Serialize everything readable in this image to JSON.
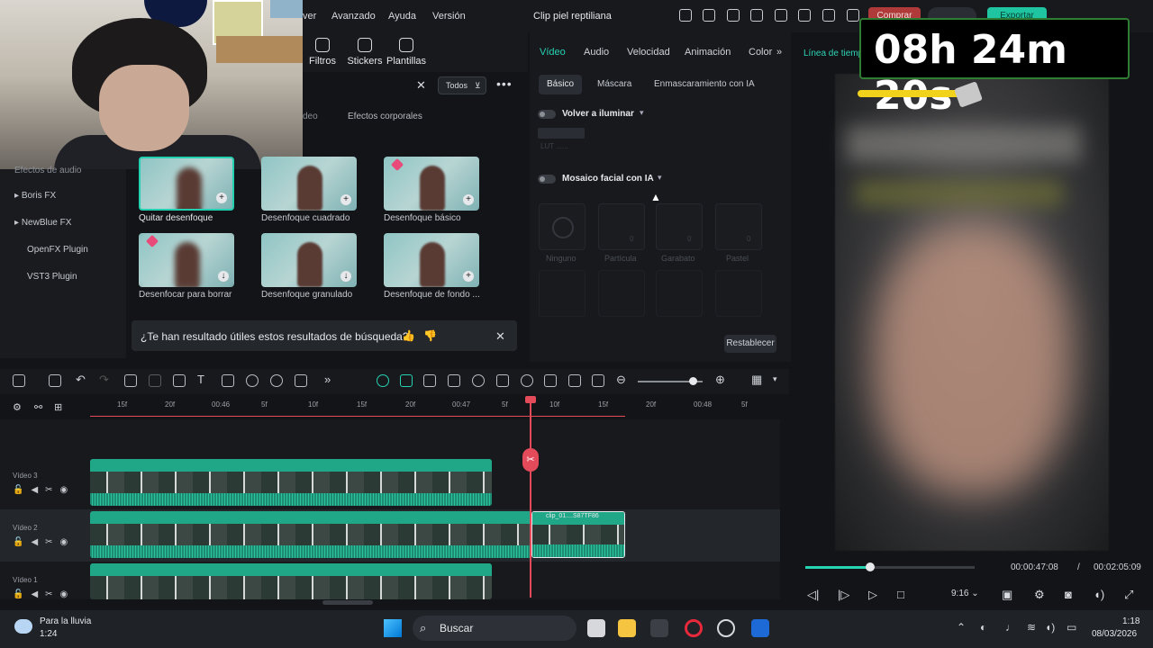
{
  "menu": {
    "items": [
      "ver",
      "Avanzado",
      "Ayuda",
      "Versión"
    ]
  },
  "project": {
    "title": "Clip piel reptiliana"
  },
  "header": {
    "buy_label": "Comprar",
    "export_label": "Exportar"
  },
  "effects_toolbar": {
    "tools": [
      "Filtros",
      "Stickers",
      "Plantillas"
    ]
  },
  "search": {
    "filter_label": "Todos"
  },
  "categories": {
    "partial": "deo",
    "tab": "Efectos corporales"
  },
  "sidebar": {
    "items": [
      "Efectos de audio",
      "Boris FX",
      "NewBlue FX",
      "OpenFX Plugin",
      "VST3 Plugin"
    ]
  },
  "effects": {
    "items": [
      {
        "label": "Quitar desenfoque"
      },
      {
        "label": "Desenfoque cuadrado"
      },
      {
        "label": "Desenfoque básico"
      },
      {
        "label": "Desenfocar para borrar"
      },
      {
        "label": "Desenfoque granulado"
      },
      {
        "label": "Desenfoque de fondo ..."
      }
    ]
  },
  "feedback": {
    "question": "¿Te han resultado útiles estos resultados de búsqueda?"
  },
  "properties": {
    "tabs": [
      "Vídeo",
      "Audio",
      "Velocidad",
      "Animación",
      "Color"
    ],
    "subtabs": [
      "Básico",
      "Máscara",
      "Enmascaramiento con IA"
    ],
    "relight_label": "Volver a iluminar",
    "relight_sub": "LUT ......",
    "mosaic_label": "Mosaico facial con IA",
    "mosaic_options": [
      "Ninguno",
      "Partícula",
      "Garabato",
      "Pastel"
    ],
    "mosaic_values": [
      "0",
      "0",
      "0"
    ],
    "reset_label": "Restablecer"
  },
  "preview": {
    "timeline_label": "Línea de tiempo",
    "timer": "08h 24m 20s",
    "current_time": "00:00:47:08",
    "separator": "/",
    "total_time": "00:02:05:09",
    "ratio": "9:16",
    "progress": 0.38
  },
  "timeline": {
    "ruler_labels": [
      "15f",
      "20f",
      "00:46",
      "5f",
      "10f",
      "15f",
      "20f",
      "00:47",
      "5f",
      "10f",
      "15f",
      "20f",
      "00:48",
      "5f"
    ],
    "tracks": [
      "Vídeo 3",
      "Vídeo 2",
      "Vídeo 1"
    ],
    "clip_name": "clip_01....S87TF86"
  },
  "taskbar": {
    "weather_title": "Para la lluvia",
    "weather_value": "1:24",
    "search_label": "Buscar",
    "time": "1:18",
    "date": "08/03/2026"
  }
}
